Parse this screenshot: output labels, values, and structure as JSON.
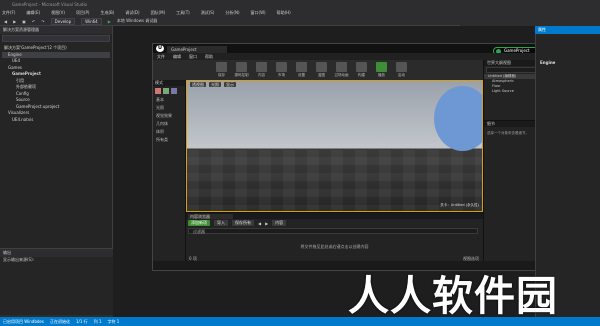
{
  "vs": {
    "title": "GameProject - Microsoft Visual Studio",
    "menu": [
      "文件(F)",
      "编辑(E)",
      "视图(V)",
      "项目(P)",
      "生成(B)",
      "调试(D)",
      "团队(M)",
      "工具(T)",
      "测试(S)",
      "分析(N)",
      "窗口(W)",
      "帮助(H)"
    ],
    "toolbar": {
      "config": "Develop",
      "platform": "Win64",
      "run": "本地 Windows 调试器"
    },
    "solution_panel_title": "解决方案资源管理器",
    "tree": [
      "解决方案'GameProject'(2 个项目)",
      "Engine",
      "UE4",
      "Games",
      "GameProject",
      "引用",
      "外部依赖项",
      "Config",
      "Source",
      "GameProject.uproject",
      "Visualizers",
      "UE4.natvis"
    ],
    "output_title": "输出",
    "output_source": "显示输出来源(S):",
    "statusbar": [
      "已启用项目 Windbdes",
      "正在初始化",
      "1/1 行",
      "列 1",
      "字符 1"
    ],
    "right_panel_title": "属性",
    "right_panel_item": "Engine"
  },
  "ue": {
    "tab": "GameProject",
    "badge": "GameProject",
    "menu": [
      "文件",
      "编辑",
      "窗口",
      "帮助"
    ],
    "toolbar": [
      "保存",
      "源码控制",
      "内容",
      "市场",
      "设置",
      "蓝图",
      "过场动画",
      "构建",
      "播放",
      "启动"
    ],
    "modes_title": "模式",
    "modes_items": [
      "基本",
      "光照",
      "视觉效果",
      "几何体",
      "体积",
      "所有类"
    ],
    "viewport_buttons": [
      "透视图",
      "光照",
      "显示"
    ],
    "viewport_label": "关卡：Untitled (永久性)",
    "outliner_title": "世界大纲视图",
    "outliner_items": [
      "Untitled (编辑器)",
      "Atmospheric",
      "Floor",
      "Light Source"
    ],
    "details_title": "细节",
    "details_hint": "选择一个对象来查看细节。",
    "content_browser_title": "内容浏览器",
    "cb_add": "添加新项",
    "cb_import": "导入",
    "cb_save": "保存所有",
    "cb_path": "内容",
    "cb_filter": "过滤器",
    "cb_empty": "将文件拖至此处或右键点击以创建内容",
    "cb_footer": "0 项",
    "view_options": "视图选项"
  },
  "watermark": "人人软件园"
}
